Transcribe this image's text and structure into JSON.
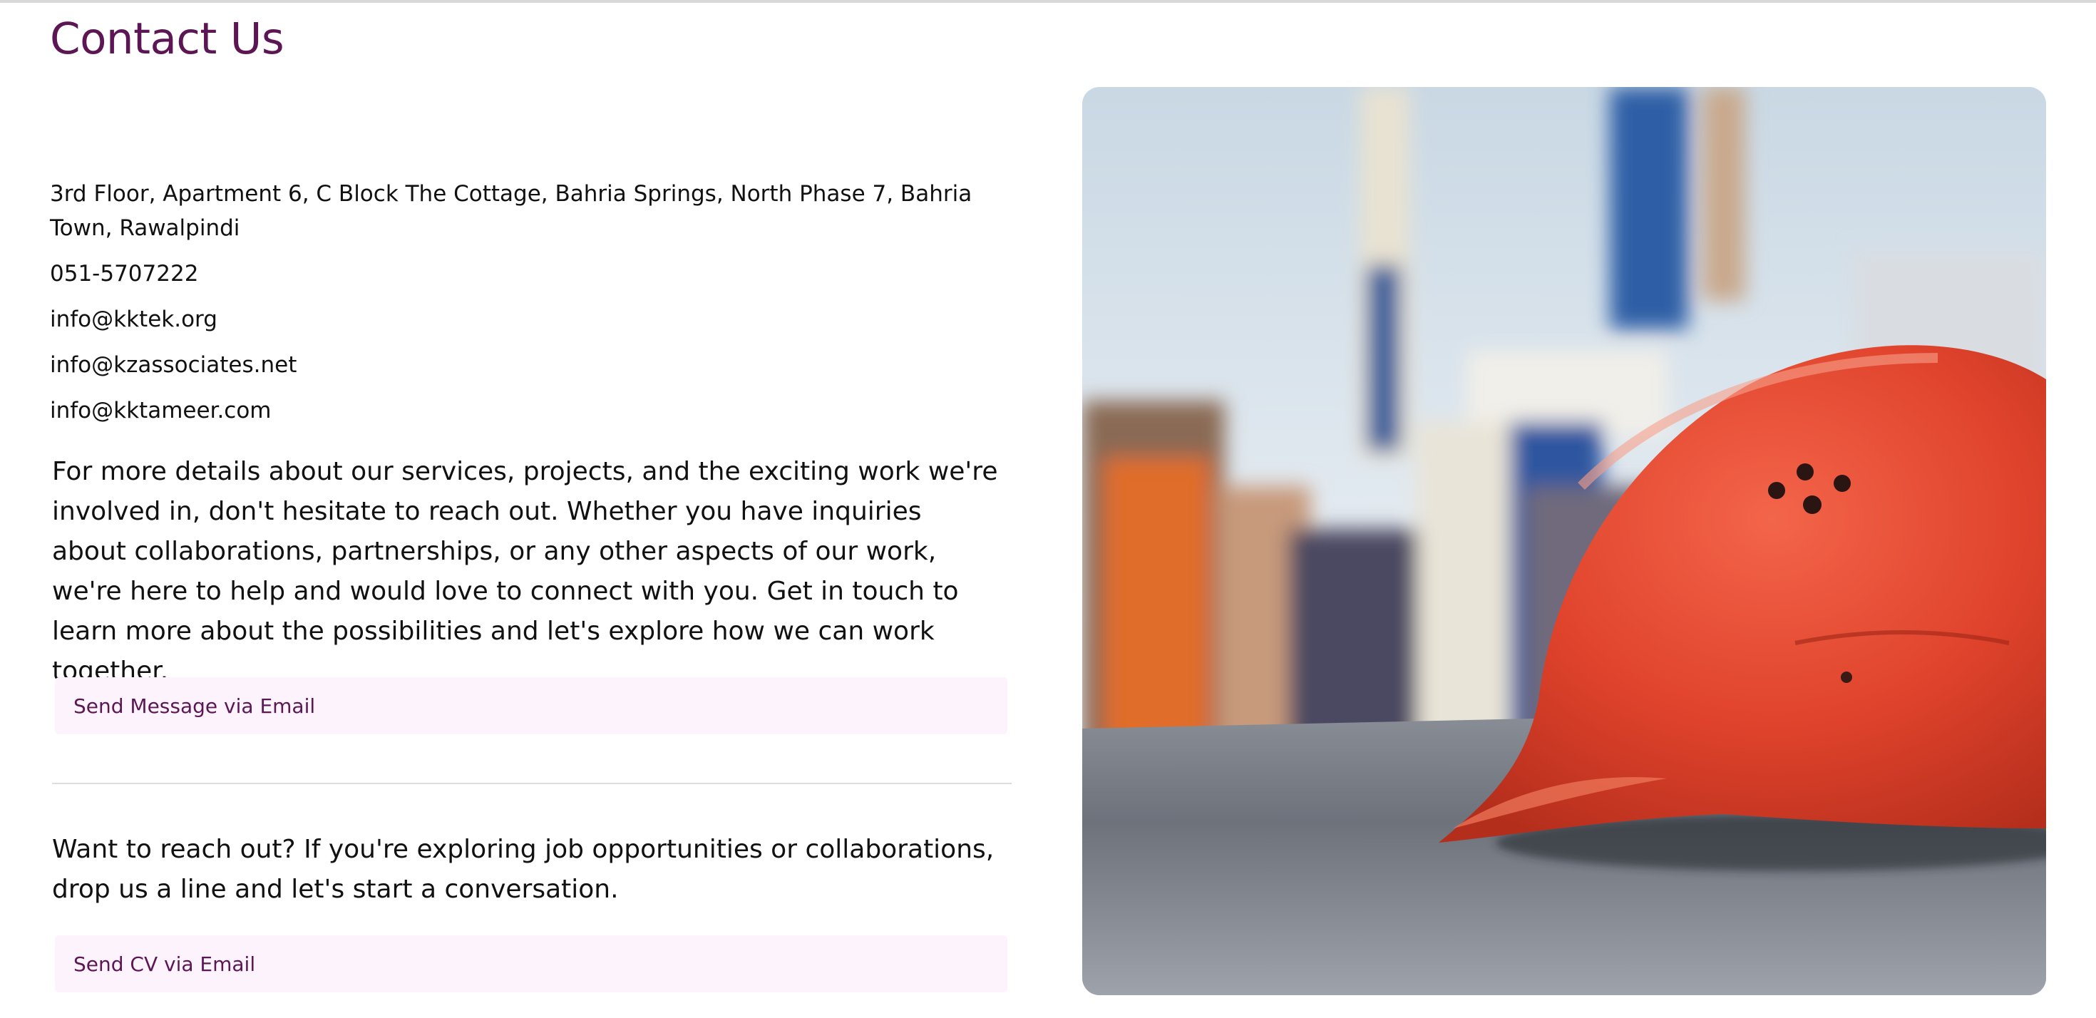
{
  "page": {
    "title": "Contact Us"
  },
  "contact": {
    "address": "3rd Floor, Apartment 6, C Block The Cottage, Bahria Springs, North Phase 7, Bahria Town, Rawalpindi",
    "phone": "051-5707222",
    "emails": [
      "info@kktek.org",
      "info@kzassociates.net",
      "info@kktameer.com"
    ]
  },
  "details": {
    "text": "For more details about our services, projects, and the exciting work we're involved in, don't hesitate to reach out. Whether you have inquiries about collaborations, partnerships, or any other aspects of our work, we're here to help and would love to connect with you. Get in touch to learn more about the possibilities and let's explore how we can work together.",
    "button_label": "Send Message via Email"
  },
  "careers": {
    "text": "Want to reach out? If you're exploring job opportunities or collaborations, drop us a line and let's start a conversation.",
    "button_label": "Send CV via Email"
  },
  "colors": {
    "accent": "#5c1654",
    "button_bg": "#fdf3fc",
    "divider": "#dddddd"
  },
  "image": {
    "icon": "hard-hat-photo"
  }
}
